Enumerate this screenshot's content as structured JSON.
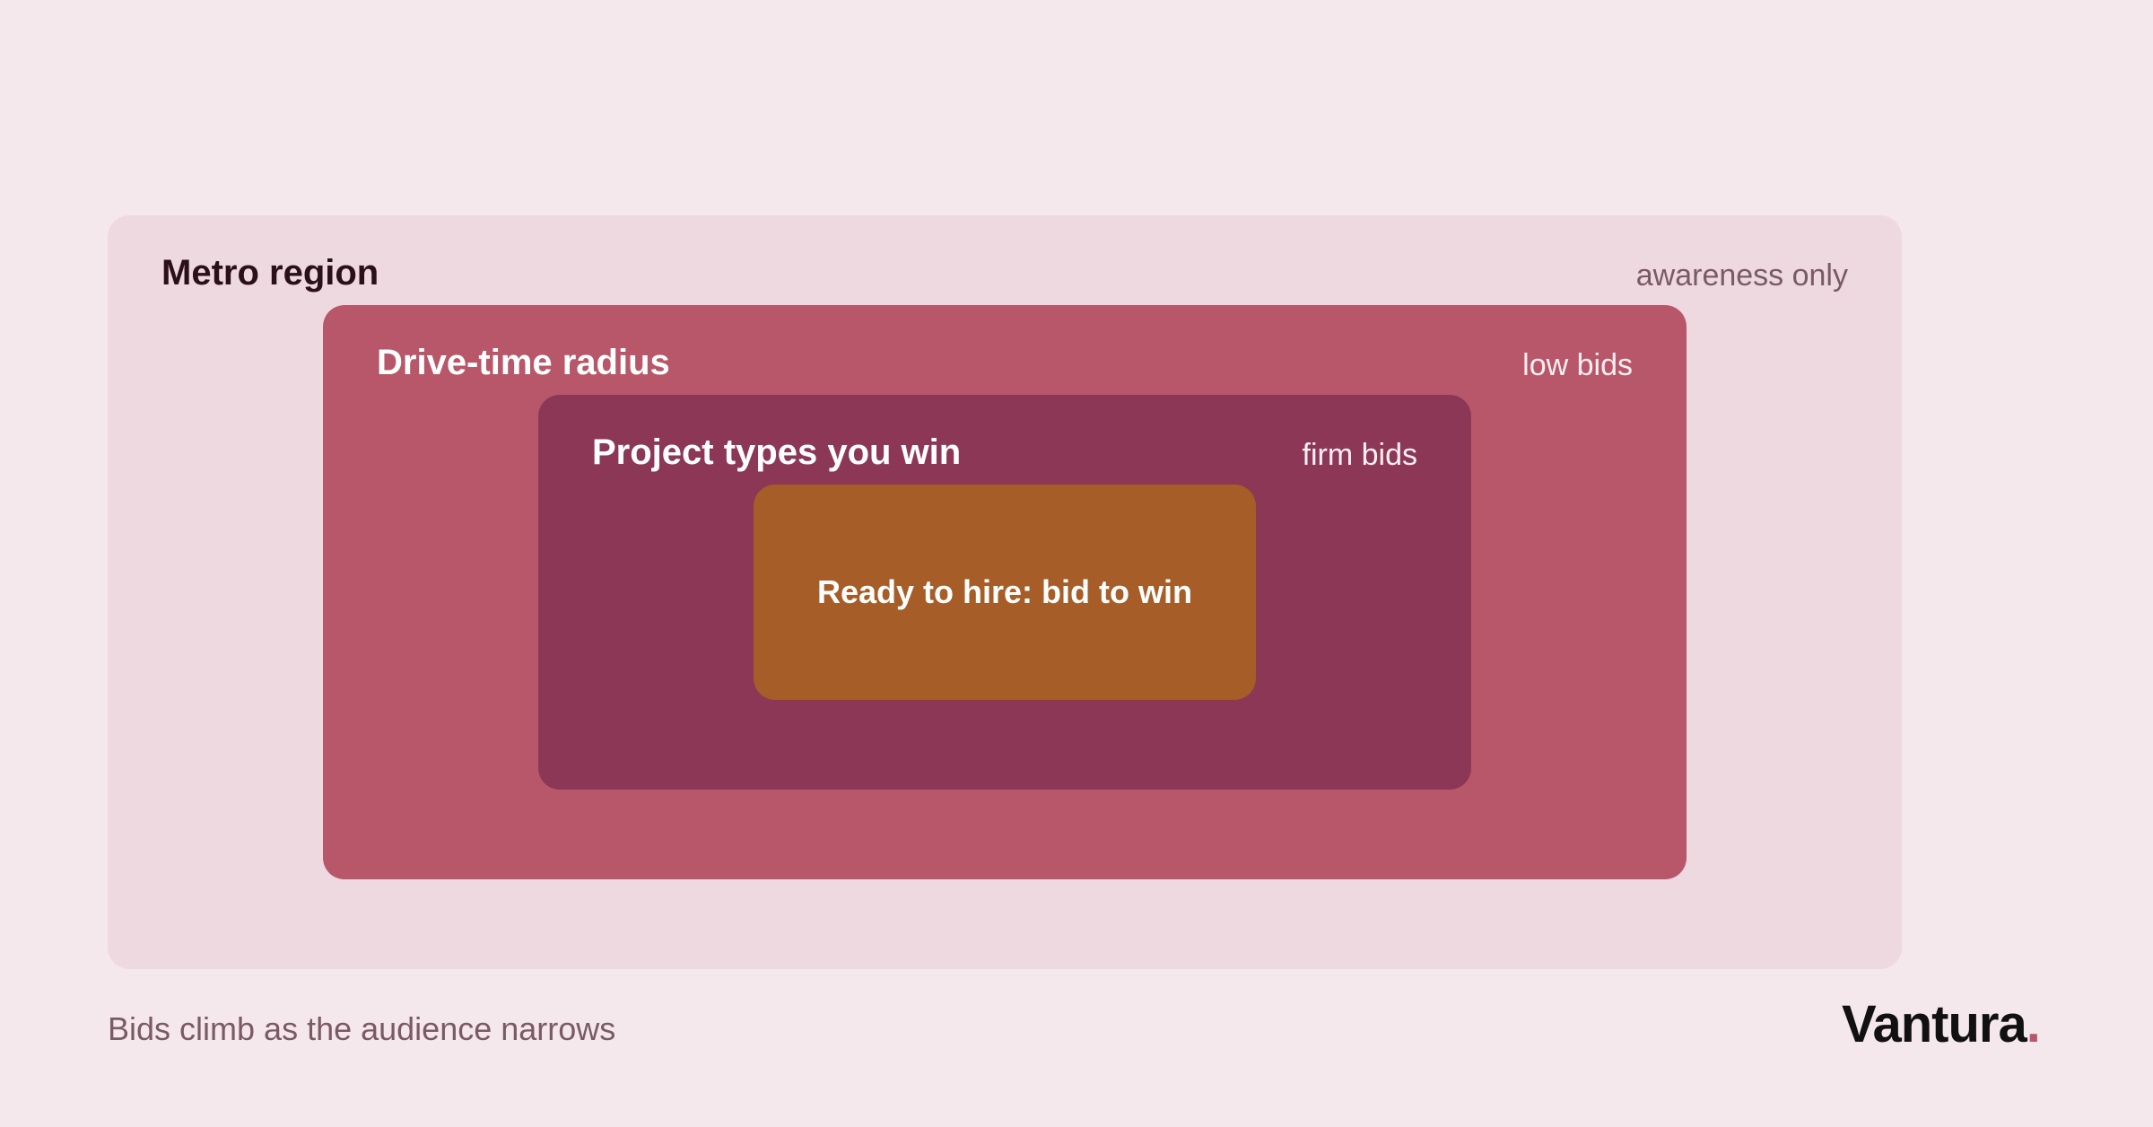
{
  "diagram": {
    "layers": [
      {
        "label": "Metro region",
        "note": "awareness only",
        "color": "#eed9e0"
      },
      {
        "label": "Drive-time radius",
        "note": "low bids",
        "color": "#b85769"
      },
      {
        "label": "Project types you win",
        "note": "firm bids",
        "color": "#8c3756"
      },
      {
        "label": "Ready to hire: bid to win",
        "color": "#a65d27"
      }
    ]
  },
  "caption": "Bids climb as the audience narrows",
  "brand": {
    "name": "Vantura",
    "dot": ".",
    "dot_color": "#b85769"
  }
}
